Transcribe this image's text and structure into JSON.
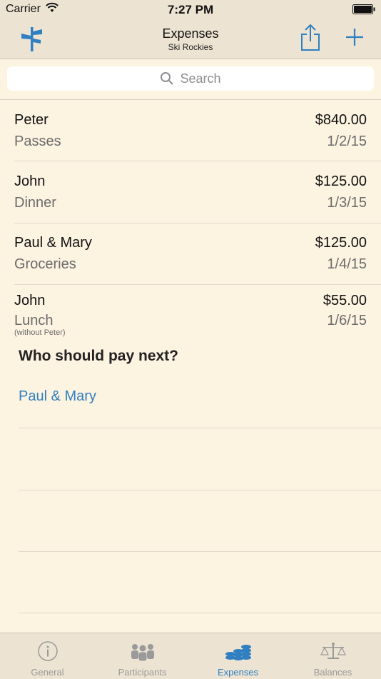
{
  "status": {
    "carrier": "Carrier",
    "time": "7:27 PM"
  },
  "nav": {
    "title": "Expenses",
    "subtitle": "Ski Rockies"
  },
  "search": {
    "placeholder": "Search"
  },
  "expenses": [
    {
      "payer": "Peter",
      "amount": "$840.00",
      "description": "Passes",
      "date": "1/2/15"
    },
    {
      "payer": "John",
      "amount": "$125.00",
      "description": "Dinner",
      "date": "1/3/15"
    },
    {
      "payer": "Paul & Mary",
      "amount": "$125.00",
      "description": "Groceries",
      "date": "1/4/15"
    },
    {
      "payer": "John",
      "amount": "$55.00",
      "description": "Lunch",
      "date": "1/6/15",
      "note": "(without Peter)"
    }
  ],
  "next_payer": {
    "heading": "Who should pay next?",
    "suggestion": "Paul & Mary"
  },
  "tabs": [
    {
      "label": "General",
      "icon": "info-icon",
      "active": false
    },
    {
      "label": "Participants",
      "icon": "people-icon",
      "active": false
    },
    {
      "label": "Expenses",
      "icon": "coins-icon",
      "active": true
    },
    {
      "label": "Balances",
      "icon": "scale-icon",
      "active": false
    }
  ],
  "colors": {
    "accent": "#2f7fc1",
    "background": "#fdf3e1",
    "bar": "#ece3d2"
  }
}
